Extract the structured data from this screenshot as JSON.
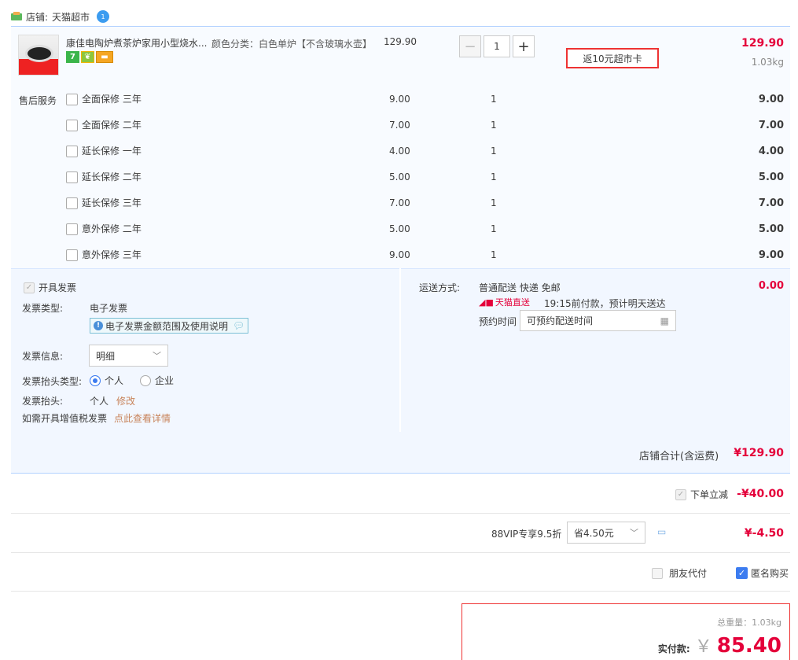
{
  "shop": {
    "label": "店铺:",
    "name": "天猫超市",
    "badge": "1"
  },
  "item": {
    "title": "康佳电陶炉煮茶炉家用小型烧水...",
    "sku": "颜色分类：白色单炉【不含玻璃水壶】",
    "unit_price": "129.90",
    "qty_minus": "−",
    "qty": "1",
    "qty_plus": "+",
    "rebate": "返10元超市卡",
    "subtotal": "129.90",
    "weight": "1.03kg",
    "tags": [
      "7",
      "",
      ""
    ]
  },
  "services": {
    "label": "售后服务",
    "rows": [
      {
        "name": "全面保修 三年",
        "price": "9.00",
        "qty": "1",
        "total": "9.00"
      },
      {
        "name": "全面保修 二年",
        "price": "7.00",
        "qty": "1",
        "total": "7.00"
      },
      {
        "name": "延长保修 一年",
        "price": "4.00",
        "qty": "1",
        "total": "4.00"
      },
      {
        "name": "延长保修 二年",
        "price": "5.00",
        "qty": "1",
        "total": "5.00"
      },
      {
        "name": "延长保修 三年",
        "price": "7.00",
        "qty": "1",
        "total": "7.00"
      },
      {
        "name": "意外保修 二年",
        "price": "5.00",
        "qty": "1",
        "total": "5.00"
      },
      {
        "name": "意外保修 三年",
        "price": "9.00",
        "qty": "1",
        "total": "9.00"
      }
    ]
  },
  "invoice": {
    "open_label": "开具发票",
    "type_label": "发票类型:",
    "type_value": "电子发票",
    "notice": "电子发票金额范围及使用说明",
    "info_label": "发票信息:",
    "info_value": "明细",
    "header_type_label": "发票抬头类型:",
    "opt_personal": "个人",
    "opt_company": "企业",
    "header_label": "发票抬头:",
    "header_value": "个人",
    "modify": "修改",
    "vat_label": "如需开具增值税发票",
    "vat_link": "点此查看详情"
  },
  "delivery": {
    "label": "运送方式:",
    "method": "普通配送 快递 免邮",
    "tmall_direct": "天猫直送",
    "note": "19:15前付款，预计明天送达",
    "appt_label": "预约时间",
    "appt_placeholder": "可预约配送时间",
    "fee": "0.00"
  },
  "shop_total": {
    "label": "店铺合计(含运费)",
    "value": "¥129.90"
  },
  "discount": {
    "label": "下单立减",
    "value": "-¥40.00"
  },
  "vip": {
    "label": "88VIP专享9.5折",
    "select": "省4.50元",
    "value": "¥-4.50"
  },
  "options": {
    "friend_pay": "朋友代付",
    "anonymous": "匿名购买"
  },
  "payment": {
    "weight_label": "总重量：",
    "weight_value": "1.03kg",
    "pay_label": "实付款:",
    "currency": "￥",
    "amount": "85.40"
  },
  "colors": {
    "accent_red": "#e4003a",
    "panel_blue": "#f2f7ff",
    "highlight_border": "#e33"
  }
}
